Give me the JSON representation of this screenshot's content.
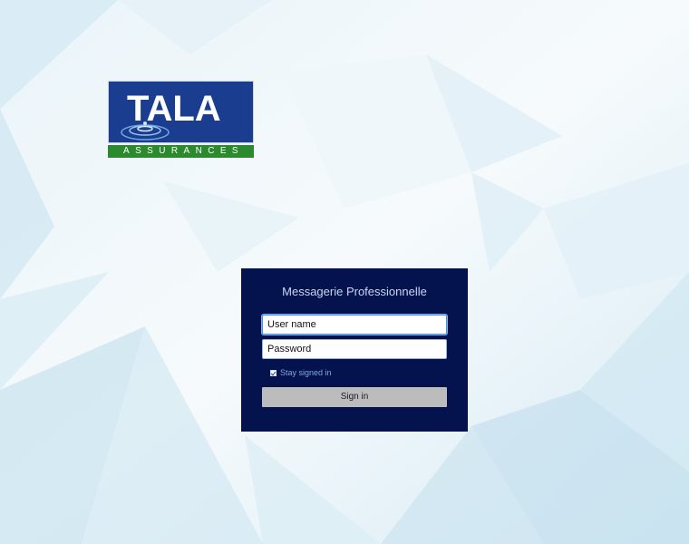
{
  "logo": {
    "word": "TALA",
    "subtitle": "ASSURANCES",
    "icon": "water-ripple-icon"
  },
  "login": {
    "title": "Messagerie Professionnelle",
    "username_placeholder": "User name",
    "password_placeholder": "Password",
    "stay_signed_in_label": "Stay signed in",
    "stay_signed_in_checked": true,
    "signin_label": "Sign in"
  },
  "colors": {
    "panel_bg": "#04134d",
    "logo_blue": "#1a3d8f",
    "logo_green": "#2c8a2e",
    "button_gray": "#bcbcbc"
  }
}
